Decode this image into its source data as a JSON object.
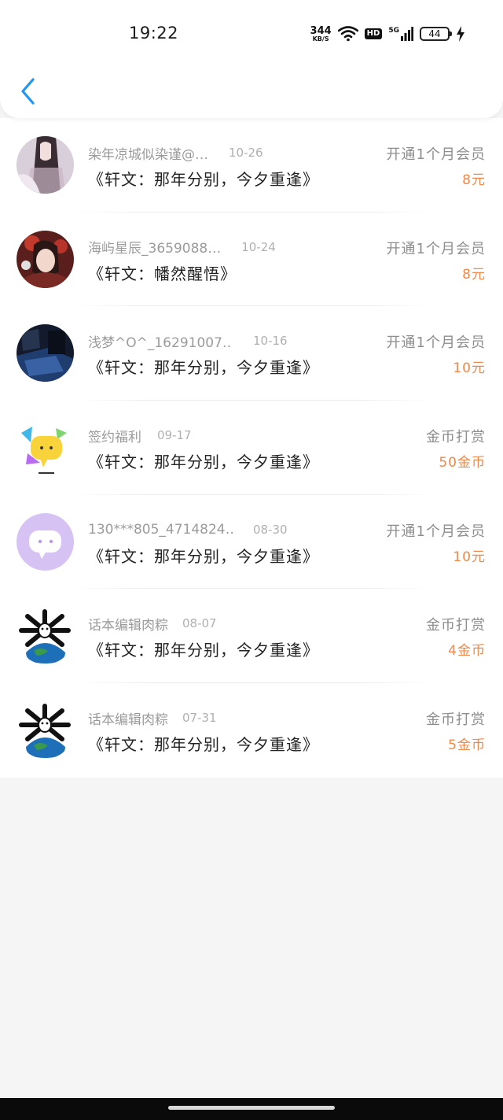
{
  "status_bar": {
    "time": "19:22",
    "net_speed_value": "344",
    "net_speed_unit": "KB/S",
    "hd_label": "HD",
    "network_label": "5G",
    "battery_level": "44"
  },
  "colors": {
    "accent_back": "#2196f3",
    "amount": "#ef8a4a"
  },
  "records": [
    {
      "user": "染年凉城似染谨@…",
      "date": "10-26",
      "title": "《轩文：那年分别，今夕重逢》",
      "type": "开通1个月会员",
      "amount": "8元",
      "avatar": "avatar-girl-purple"
    },
    {
      "user": "海屿星辰_3659088…",
      "date": "10-24",
      "title": "《轩文：幡然醒悟》",
      "type": "开通1个月会员",
      "amount": "8元",
      "avatar": "avatar-girl-red"
    },
    {
      "user": "浅梦^O^_16291007…",
      "date": "10-16",
      "title": "《轩文：那年分别，今夕重逢》",
      "type": "开通1个月会员",
      "amount": "10元",
      "avatar": "avatar-dark-photo"
    },
    {
      "user": "签约福利",
      "date": "09-17",
      "title": "《轩文：那年分别，今夕重逢》",
      "type": "金币打赏",
      "amount": "50金币",
      "avatar": "avatar-chat-yellow"
    },
    {
      "user": "130***805_4714824…",
      "date": "08-30",
      "title": "《轩文：那年分别，今夕重逢》",
      "type": "开通1个月会员",
      "amount": "10元",
      "avatar": "avatar-chat-purple"
    },
    {
      "user": "话本编辑肉粽",
      "date": "08-07",
      "title": "《轩文：那年分别，今夕重逢》",
      "type": "金币打赏",
      "amount": "4金币",
      "avatar": "avatar-earth"
    },
    {
      "user": "话本编辑肉粽",
      "date": "07-31",
      "title": "《轩文：那年分别，今夕重逢》",
      "type": "金币打赏",
      "amount": "5金币",
      "avatar": "avatar-earth"
    }
  ]
}
